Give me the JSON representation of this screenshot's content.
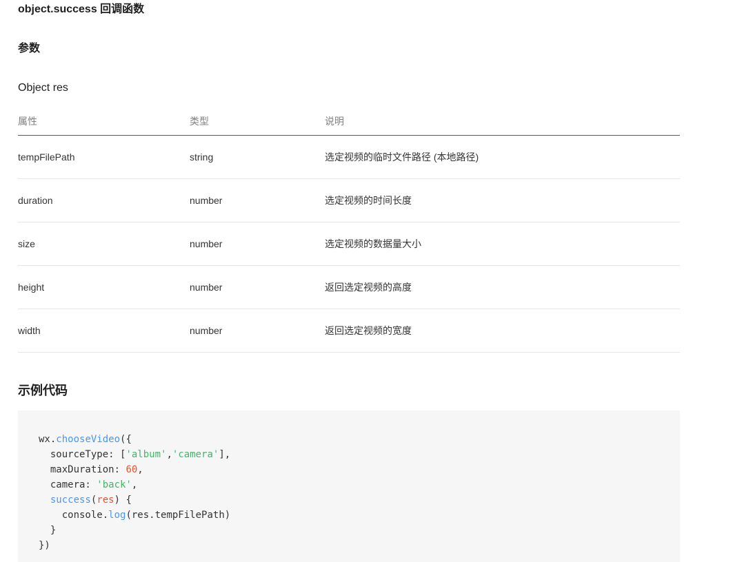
{
  "headings": {
    "callback": "object.success 回调函数",
    "params": "参数",
    "object": "Object res",
    "example": "示例代码"
  },
  "table": {
    "headers": [
      "属性",
      "类型",
      "说明"
    ],
    "rows": [
      {
        "name": "tempFilePath",
        "type": "string",
        "desc": "选定视频的临时文件路径 (本地路径)"
      },
      {
        "name": "duration",
        "type": "number",
        "desc": "选定视频的时间长度"
      },
      {
        "name": "size",
        "type": "number",
        "desc": "选定视频的数据量大小"
      },
      {
        "name": "height",
        "type": "number",
        "desc": "返回选定视频的高度"
      },
      {
        "name": "width",
        "type": "number",
        "desc": "返回选定视频的宽度"
      }
    ]
  },
  "code": {
    "lines": [
      [
        {
          "t": "wx."
        },
        {
          "t": "chooseVideo",
          "c": "fn"
        },
        {
          "t": "({"
        }
      ],
      [
        {
          "t": "  sourceType: ["
        },
        {
          "t": "'album'",
          "c": "str"
        },
        {
          "t": ","
        },
        {
          "t": "'camera'",
          "c": "str"
        },
        {
          "t": "],"
        }
      ],
      [
        {
          "t": "  maxDuration: "
        },
        {
          "t": "60",
          "c": "num"
        },
        {
          "t": ","
        }
      ],
      [
        {
          "t": "  camera: "
        },
        {
          "t": "'back'",
          "c": "str"
        },
        {
          "t": ","
        }
      ],
      [
        {
          "t": "  "
        },
        {
          "t": "success",
          "c": "fn"
        },
        {
          "t": "("
        },
        {
          "t": "res",
          "c": "param"
        },
        {
          "t": ") {"
        }
      ],
      [
        {
          "t": "    console."
        },
        {
          "t": "log",
          "c": "fn"
        },
        {
          "t": "(res.tempFilePath)"
        }
      ],
      [
        {
          "t": "  }"
        }
      ],
      [
        {
          "t": "})"
        }
      ]
    ]
  },
  "colors": {
    "code_function": "#4a98e8",
    "code_string": "#46b36a",
    "code_number": "#e8532f",
    "code_background": "#f6f6f6"
  }
}
